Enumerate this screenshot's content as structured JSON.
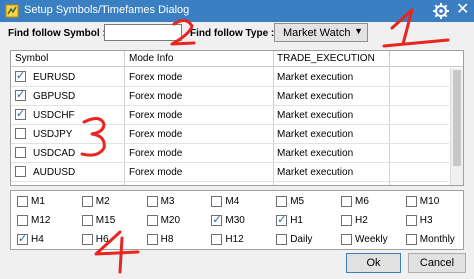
{
  "window": {
    "title": "Setup Symbols/Timefames Dialog"
  },
  "filters": {
    "symbol_label": "Find follow Symbol :",
    "symbol_value": "",
    "type_label": "Find follow Type :",
    "type_value": "Market Watch"
  },
  "table": {
    "columns": [
      "Symbol",
      "Mode Info",
      "TRADE_EXECUTION"
    ],
    "rows": [
      {
        "checked": true,
        "symbol": "EURUSD",
        "mode": "Forex mode",
        "execution": "Market execution"
      },
      {
        "checked": true,
        "symbol": "GBPUSD",
        "mode": "Forex mode",
        "execution": "Market execution"
      },
      {
        "checked": true,
        "symbol": "USDCHF",
        "mode": "Forex mode",
        "execution": "Market execution"
      },
      {
        "checked": false,
        "symbol": "USDJPY",
        "mode": "Forex mode",
        "execution": "Market execution"
      },
      {
        "checked": false,
        "symbol": "USDCAD",
        "mode": "Forex mode",
        "execution": "Market execution"
      },
      {
        "checked": false,
        "symbol": "AUDUSD",
        "mode": "Forex mode",
        "execution": "Market execution"
      }
    ]
  },
  "timeframes": [
    {
      "label": "M1",
      "checked": false
    },
    {
      "label": "M2",
      "checked": false
    },
    {
      "label": "M3",
      "checked": false
    },
    {
      "label": "M4",
      "checked": false
    },
    {
      "label": "M5",
      "checked": false
    },
    {
      "label": "M6",
      "checked": false
    },
    {
      "label": "M10",
      "checked": false
    },
    {
      "label": "M12",
      "checked": false
    },
    {
      "label": "M15",
      "checked": false
    },
    {
      "label": "M20",
      "checked": false
    },
    {
      "label": "M30",
      "checked": true
    },
    {
      "label": "H1",
      "checked": true
    },
    {
      "label": "H2",
      "checked": false
    },
    {
      "label": "H3",
      "checked": false
    },
    {
      "label": "H4",
      "checked": true
    },
    {
      "label": "H6",
      "checked": false
    },
    {
      "label": "H8",
      "checked": false
    },
    {
      "label": "H12",
      "checked": false
    },
    {
      "label": "Daily",
      "checked": false
    },
    {
      "label": "Weekly",
      "checked": false
    },
    {
      "label": "Monthly",
      "checked": false
    }
  ],
  "buttons": {
    "ok": "Ok",
    "cancel": "Cancel"
  },
  "annotations": [
    "1",
    "2",
    "3",
    "4"
  ],
  "colors": {
    "titlebar": "#3a7fc1",
    "check": "#2a62b0",
    "annotation": "#e8251f"
  },
  "icons": {
    "app": "app-icon",
    "settings": "gear-icon",
    "close": "close-icon",
    "dropdown": "chevron-down-icon"
  }
}
